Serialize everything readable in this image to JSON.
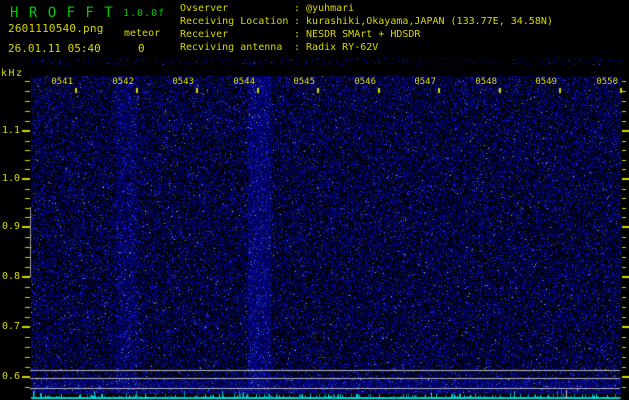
{
  "app": {
    "title": "H R O F F T",
    "version": "1.0.0f",
    "filename": "2601110540.png",
    "datetime": "26.01.11 05:40",
    "meteor_label": "meteor",
    "meteor_count": "0"
  },
  "station_info": {
    "rows": [
      {
        "label": "Ovserver",
        "value": "@yuhmari"
      },
      {
        "label": "Receiving Location",
        "value": "kurashiki,Okayama,JAPAN (133.77E, 34.58N)"
      },
      {
        "label": "Receiver",
        "value": "NESDR SMArt + HDSDR"
      },
      {
        "label": "Recviving antenna",
        "value": "Radix RY-62V"
      }
    ]
  },
  "chart": {
    "type": "spectrogram",
    "unit_label": "kHz",
    "freq_ticks": [
      "1.1",
      "1.0",
      "0.9",
      "0.8",
      "0.7",
      "0.6"
    ],
    "time_ticks": [
      "0541",
      "0542",
      "0543",
      "0544",
      "0545",
      "0546",
      "0547",
      "0548",
      "0549",
      "0550"
    ],
    "colors": {
      "background": "#000000",
      "text_green": "#00cc00",
      "text_yellow": "#d8d800",
      "tick": "#d8d800",
      "noise_dim": "#0000a0",
      "noise_mid": "#1828c8",
      "noise_bright": "#4060ff",
      "noise_spark": "#9adcff",
      "level_line": "#c8c8c8",
      "marker_gray": "#999999",
      "signal_cyan": "#00e6e6",
      "signal_dim_cyan": "#00a0b8",
      "spike_white": "#cccccc"
    }
  }
}
